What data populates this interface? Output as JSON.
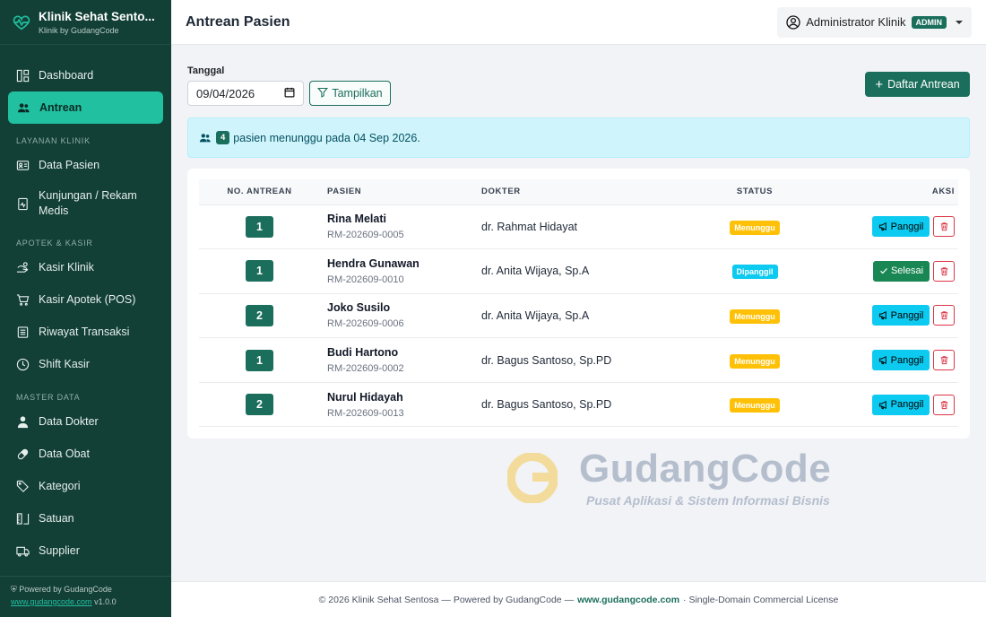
{
  "brand": {
    "title": "Klinik Sehat Sento...",
    "subtitle": "Klinik by GudangCode",
    "logo_icon": "heart-pulse-icon"
  },
  "sidebar": {
    "main_items": [
      {
        "label": "Dashboard",
        "icon": "dashboard-icon"
      },
      {
        "label": "Antrean",
        "icon": "people-icon",
        "active": true
      }
    ],
    "sections": [
      {
        "title": "LAYANAN KLINIK",
        "items": [
          {
            "label": "Data Pasien",
            "icon": "id-card-icon"
          },
          {
            "label": "Kunjungan / Rekam Medis",
            "icon": "medical-record-icon"
          }
        ]
      },
      {
        "title": "APOTEK & KASIR",
        "items": [
          {
            "label": "Kasir Klinik",
            "icon": "cash-register-icon"
          },
          {
            "label": "Kasir Apotek (POS)",
            "icon": "cart-icon"
          },
          {
            "label": "Riwayat Transaksi",
            "icon": "receipt-icon"
          },
          {
            "label": "Shift Kasir",
            "icon": "clock-icon"
          }
        ]
      },
      {
        "title": "MASTER DATA",
        "items": [
          {
            "label": "Data Dokter",
            "icon": "doctor-icon"
          },
          {
            "label": "Data Obat",
            "icon": "capsule-icon"
          },
          {
            "label": "Kategori",
            "icon": "tag-icon"
          },
          {
            "label": "Satuan",
            "icon": "ruler-icon"
          },
          {
            "label": "Supplier",
            "icon": "truck-icon"
          }
        ]
      }
    ],
    "footer": {
      "powered": "Powered by GudangCode",
      "link": "www.gudangcode.com",
      "version": "v1.0.0"
    }
  },
  "header": {
    "title": "Antrean Pasien",
    "user_name": "Administrator Klinik",
    "user_badge": "ADMIN"
  },
  "filter": {
    "date_label": "Tanggal",
    "date_value": "09/04/2026",
    "show_button": "Tampilkan",
    "add_button": "Daftar Antrean"
  },
  "alert": {
    "count": "4",
    "text": "pasien menunggu pada 04 Sep 2026."
  },
  "table": {
    "headers": {
      "no": "NO. ANTREAN",
      "patient": "PASIEN",
      "doctor": "DOKTER",
      "status": "STATUS",
      "action": "AKSI"
    },
    "rows": [
      {
        "no": "1",
        "name": "Rina Melati",
        "rm": "RM-202609-0005",
        "doctor": "dr. Rahmat Hidayat",
        "status": "Menunggu",
        "status_type": "wait",
        "action": "Panggil"
      },
      {
        "no": "1",
        "name": "Hendra Gunawan",
        "rm": "RM-202609-0010",
        "doctor": "dr. Anita Wijaya, Sp.A",
        "status": "Dipanggil",
        "status_type": "called",
        "action": "Selesai"
      },
      {
        "no": "2",
        "name": "Joko Susilo",
        "rm": "RM-202609-0006",
        "doctor": "dr. Anita Wijaya, Sp.A",
        "status": "Menunggu",
        "status_type": "wait",
        "action": "Panggil"
      },
      {
        "no": "1",
        "name": "Budi Hartono",
        "rm": "RM-202609-0002",
        "doctor": "dr. Bagus Santoso, Sp.PD",
        "status": "Menunggu",
        "status_type": "wait",
        "action": "Panggil"
      },
      {
        "no": "2",
        "name": "Nurul Hidayah",
        "rm": "RM-202609-0013",
        "doctor": "dr. Bagus Santoso, Sp.PD",
        "status": "Menunggu",
        "status_type": "wait",
        "action": "Panggil"
      }
    ]
  },
  "watermark": {
    "title": "GudangCode",
    "subtitle": "Pusat Aplikasi & Sistem Informasi Bisnis"
  },
  "footer": {
    "left": "© 2026 Klinik Sehat Sentosa — Powered by GudangCode —",
    "link": "www.gudangcode.com",
    "right": "· Single-Domain Commercial License"
  },
  "colors": {
    "sidebar": "#123f36",
    "accent": "#20c0a0",
    "primary": "#1b6e5c",
    "info": "#0dcaf0",
    "warning": "#ffc107",
    "success": "#198754",
    "danger": "#dc3545"
  }
}
